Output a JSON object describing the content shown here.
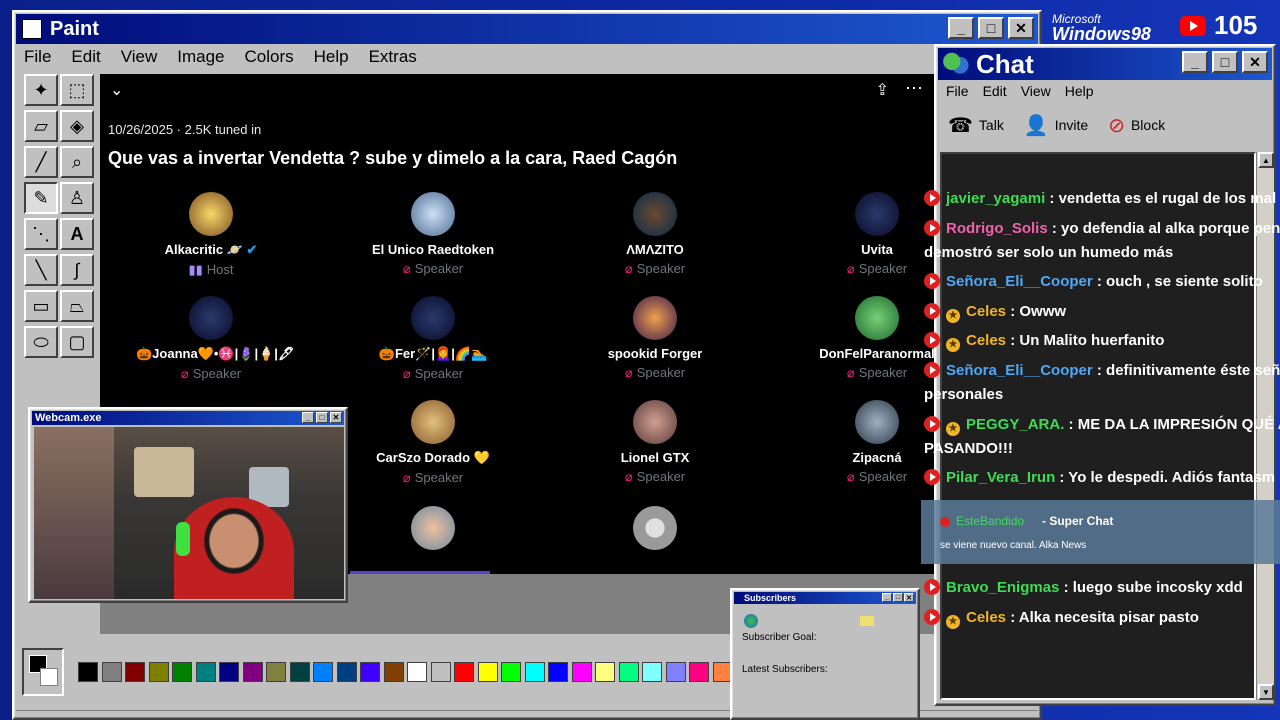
{
  "paint": {
    "title": "Paint",
    "menu": [
      "File",
      "Edit",
      "View",
      "Image",
      "Colors",
      "Help",
      "Extras"
    ]
  },
  "overlay": {
    "microsoft": "Microsoft",
    "windows98": "Windows98",
    "viewer_count": "105"
  },
  "space": {
    "date_line": "10/26/2025 · 2.5K tuned in",
    "title": "Que vas a invertar Vendetta ? sube y dimelo a la cara, Raed Cagón",
    "speakers": [
      {
        "name": "Alkacritic 🪐",
        "role": "Host",
        "verified": true
      },
      {
        "name": "El Unico Raedtoken",
        "role": "Speaker"
      },
      {
        "name": "ΛMΛZITO",
        "role": "Speaker"
      },
      {
        "name": "Uvita",
        "role": "Speaker"
      },
      {
        "name": "🎃Joanna🧡•♓|🪻|🍦|🖋",
        "role": "Speaker"
      },
      {
        "name": "🎃Fer🪄|👩‍🦰|🌈🏊",
        "role": "Speaker"
      },
      {
        "name": "spookid Forger",
        "role": "Speaker"
      },
      {
        "name": "DonFelParanormal",
        "role": "Speaker"
      },
      {
        "name": "CarSzo Dorado 💛",
        "role": "Speaker"
      },
      {
        "name": "Lionel GTX",
        "role": "Speaker"
      },
      {
        "name": "Zipacná",
        "role": "Speaker"
      }
    ]
  },
  "webcam": {
    "title": "Webcam.exe"
  },
  "subscribers": {
    "title": "Subscribers",
    "goal_label": "Subscriber Goal:",
    "latest_label": "Latest Subscribers:"
  },
  "chat": {
    "title": "Chat",
    "menu": [
      "File",
      "Edit",
      "View",
      "Help"
    ],
    "tools": [
      "Talk",
      "Invite",
      "Block"
    ],
    "messages": [
      {
        "user": "javier_yagami",
        "text": ": vendetta es el rugal de los mal"
      },
      {
        "user": "Rodrigo_Solis",
        "text": ": yo defendia al alka porque pen",
        "cont": "demostró ser solo un humedo más"
      },
      {
        "user": "Señora_Eli__Cooper",
        "text": ": ouch , se siente solito"
      },
      {
        "user": "Celes",
        "text": ": Owww"
      },
      {
        "user": "Celes",
        "text": ": Un Malito huerfanito"
      },
      {
        "user": "Señora_Eli__Cooper",
        "text": ": definitivamente éste señ",
        "cont": "personales"
      },
      {
        "user": "PEGGY_ARA.",
        "text": ": ME DA LA IMPRESIÓN QUÉ A",
        "cont": "PASANDO!!!"
      },
      {
        "user": "Pilar_Vera_Irun",
        "text": ": Yo le despedi. Adiós fantasm"
      },
      {
        "user": "Bravo_Enigmas",
        "text": ": luego sube incosky xdd"
      },
      {
        "user": "Celes",
        "text": ": Alka necesita pisar pasto"
      }
    ],
    "superchat": {
      "user": "EsteBandido",
      "label": "- Super Chat",
      "text": "se viene nuevo canal. Alka News"
    }
  }
}
